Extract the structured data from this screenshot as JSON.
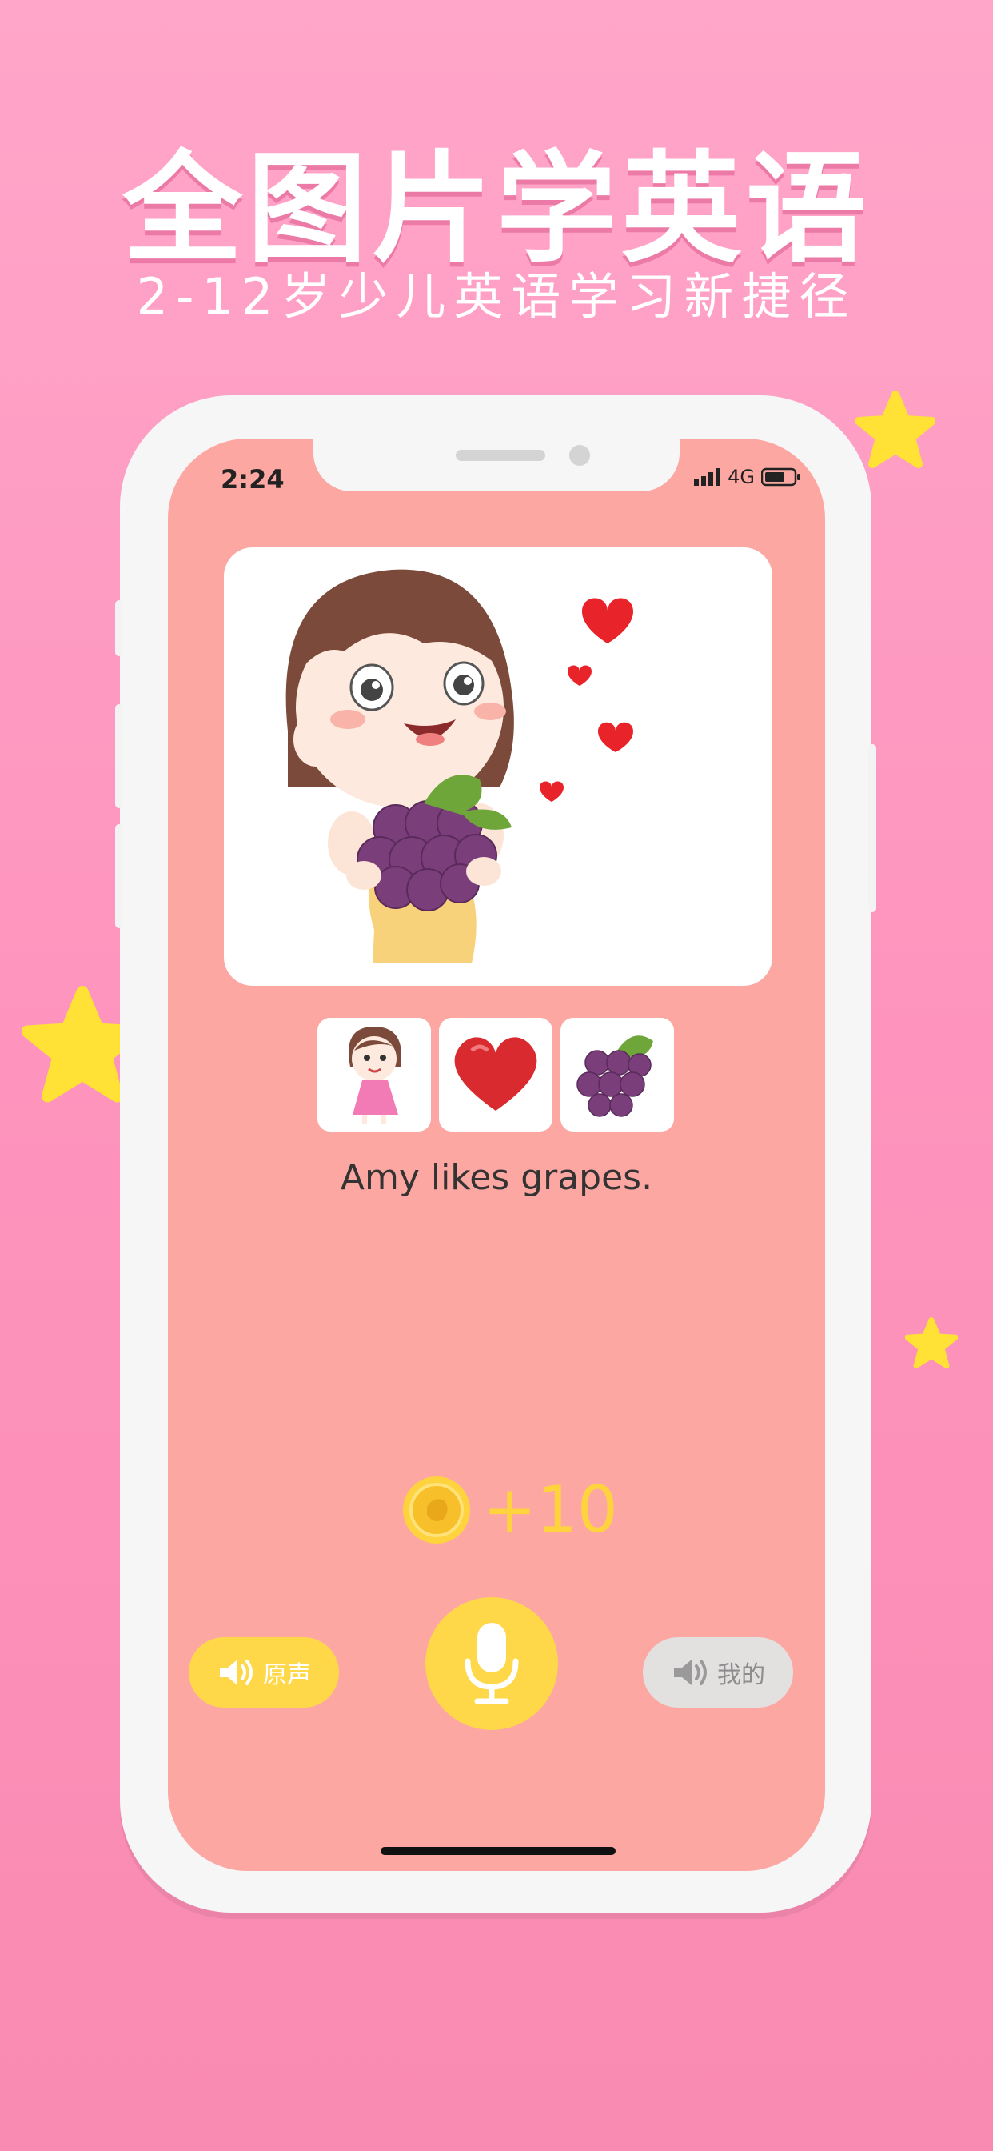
{
  "promo": {
    "headline": "全图片学英语",
    "subheadline": "2-12岁少儿英语学习新捷径"
  },
  "status_bar": {
    "time": "2:24",
    "network": "4G"
  },
  "lesson": {
    "main_image": "girl-holding-grapes-with-hearts",
    "thumbnails": [
      "girl-icon",
      "heart-icon",
      "grapes-icon"
    ],
    "sentence": "Amy likes grapes."
  },
  "reward": {
    "text": "+10",
    "icon": "coin-icon"
  },
  "controls": {
    "original_label": "原声",
    "mine_label": "我的",
    "record_icon": "microphone-icon"
  },
  "colors": {
    "background": "#FFA6C9",
    "screen": "#FDA7A3",
    "accent_yellow": "#FFD84A",
    "disabled_gray": "#E3E0E0"
  }
}
